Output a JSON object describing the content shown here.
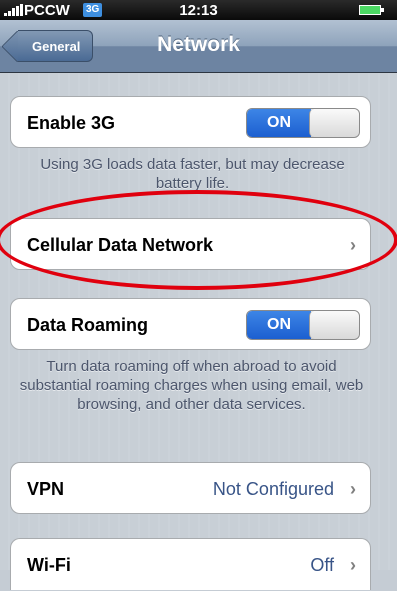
{
  "status_bar": {
    "carrier": "PCCW",
    "network_badge": "3G",
    "time": "12:13"
  },
  "nav": {
    "back_label": "General",
    "title": "Network"
  },
  "enable_3g": {
    "label": "Enable 3G",
    "toggle_state": "ON",
    "note": "Using 3G loads data faster, but may decrease battery life."
  },
  "cellular_data_network": {
    "label": "Cellular Data Network"
  },
  "data_roaming": {
    "label": "Data Roaming",
    "toggle_state": "ON",
    "note": "Turn data roaming off when abroad to avoid substantial roaming charges when using email, web browsing, and other data services."
  },
  "vpn": {
    "label": "VPN",
    "value": "Not Configured"
  },
  "wifi": {
    "label": "Wi-Fi",
    "value": "Off"
  },
  "colors": {
    "toggle_on": "#1c5fd0",
    "highlight_ellipse": "#e0000e",
    "value_text": "#385487"
  }
}
